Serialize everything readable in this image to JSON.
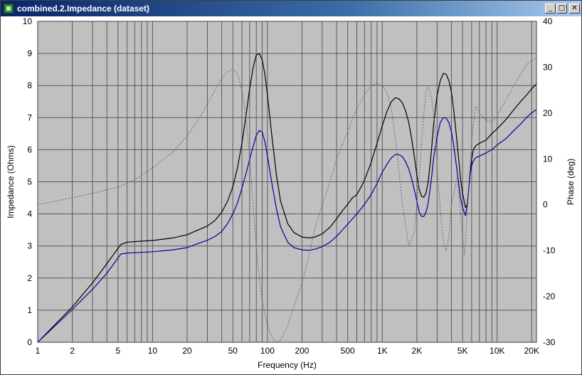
{
  "window": {
    "title": "combined.2.Impedance (dataset)",
    "min_label": "_",
    "max_label": "□",
    "close_label": "✕"
  },
  "colors": {
    "plot_bg": "#c0c0c0",
    "grid": "#5a5a5a",
    "series_black": "#000000",
    "series_blue": "#0000a0",
    "series_phase": "#6a6a6a"
  },
  "chart_data": {
    "type": "line",
    "xlabel": "Frequency (Hz)",
    "ylabel": "Impedance (Ohms)",
    "y2label": "Phase (deg)",
    "xscale": "log",
    "xlim": [
      1,
      22000
    ],
    "ylim": [
      0,
      10
    ],
    "y2lim": [
      -30,
      40
    ],
    "grid": true,
    "x_tick_labels": [
      {
        "value": 1,
        "label": "1"
      },
      {
        "value": 2,
        "label": "2"
      },
      {
        "value": 5,
        "label": "5"
      },
      {
        "value": 10,
        "label": "10"
      },
      {
        "value": 20,
        "label": "20"
      },
      {
        "value": 50,
        "label": "50"
      },
      {
        "value": 100,
        "label": "100"
      },
      {
        "value": 200,
        "label": "200"
      },
      {
        "value": 500,
        "label": "500"
      },
      {
        "value": 1000,
        "label": "1K"
      },
      {
        "value": 2000,
        "label": "2K"
      },
      {
        "value": 5000,
        "label": "5K"
      },
      {
        "value": 10000,
        "label": "10K"
      },
      {
        "value": 20000,
        "label": "20K"
      }
    ],
    "x_grid": [
      1,
      2,
      3,
      4,
      5,
      6,
      7,
      8,
      9,
      10,
      20,
      30,
      40,
      50,
      60,
      70,
      80,
      90,
      100,
      200,
      300,
      400,
      500,
      600,
      700,
      800,
      900,
      1000,
      2000,
      3000,
      4000,
      5000,
      6000,
      7000,
      8000,
      9000,
      10000,
      20000
    ],
    "y_ticks": [
      0,
      1,
      2,
      3,
      4,
      5,
      6,
      7,
      8,
      9,
      10
    ],
    "y2_ticks": [
      -30,
      -20,
      -10,
      0,
      10,
      20,
      30,
      40
    ],
    "series": [
      {
        "axis": "left",
        "style": "solid",
        "color": "#000000",
        "x": [
          1,
          2,
          3,
          4,
          5.3,
          6,
          8,
          10,
          15,
          20,
          25,
          30,
          35,
          40,
          45,
          50,
          55,
          60,
          65,
          70,
          75,
          80,
          85,
          90,
          95,
          100,
          110,
          120,
          130,
          150,
          170,
          200,
          230,
          260,
          300,
          350,
          400,
          450,
          500,
          550,
          600,
          650,
          700,
          800,
          900,
          1000,
          1100,
          1200,
          1300,
          1400,
          1500,
          1600,
          1700,
          1800,
          1900,
          2000,
          2100,
          2200,
          2300,
          2400,
          2500,
          2600,
          2700,
          2800,
          3000,
          3200,
          3400,
          3600,
          3800,
          4000,
          4200,
          4400,
          4600,
          4800,
          5000,
          5300,
          5500,
          5800,
          6000,
          6200,
          6500,
          7000,
          8000,
          9000,
          10000,
          12000,
          14000,
          16000,
          18000,
          20000,
          22000
        ],
        "y": [
          0,
          1.1,
          1.85,
          2.45,
          3.05,
          3.12,
          3.15,
          3.17,
          3.25,
          3.35,
          3.5,
          3.62,
          3.8,
          4.05,
          4.4,
          4.85,
          5.45,
          6.2,
          7.05,
          7.9,
          8.55,
          8.95,
          9,
          8.8,
          8.35,
          7.7,
          6.35,
          5.2,
          4.4,
          3.7,
          3.42,
          3.28,
          3.25,
          3.28,
          3.38,
          3.58,
          3.85,
          4.1,
          4.3,
          4.5,
          4.6,
          4.82,
          5.05,
          5.6,
          6.2,
          6.75,
          7.2,
          7.5,
          7.62,
          7.58,
          7.45,
          7.2,
          6.85,
          6.35,
          5.8,
          5.2,
          4.75,
          4.55,
          4.52,
          4.65,
          4.95,
          5.5,
          6.1,
          6.8,
          7.7,
          8.15,
          8.38,
          8.35,
          8.15,
          7.8,
          7.2,
          6.5,
          5.8,
          5.1,
          4.65,
          4.2,
          4.3,
          5.2,
          5.7,
          6,
          6.12,
          6.2,
          6.3,
          6.5,
          6.65,
          6.95,
          7.25,
          7.5,
          7.7,
          7.9,
          8.05
        ]
      },
      {
        "axis": "left",
        "style": "solid",
        "color": "#0000a0",
        "x": [
          1,
          2,
          3,
          4,
          5.3,
          6,
          8,
          10,
          15,
          20,
          25,
          30,
          35,
          40,
          45,
          50,
          55,
          60,
          65,
          70,
          75,
          80,
          85,
          90,
          95,
          100,
          110,
          120,
          130,
          150,
          170,
          200,
          230,
          260,
          300,
          350,
          400,
          450,
          500,
          550,
          600,
          650,
          700,
          800,
          900,
          1000,
          1100,
          1200,
          1300,
          1400,
          1500,
          1600,
          1700,
          1800,
          1900,
          2000,
          2100,
          2200,
          2300,
          2400,
          2500,
          2600,
          2700,
          2800,
          3000,
          3200,
          3400,
          3600,
          3800,
          4000,
          4200,
          4400,
          4600,
          4800,
          5000,
          5300,
          5500,
          5800,
          6000,
          6200,
          6500,
          7000,
          8000,
          9000,
          10000,
          12000,
          14000,
          16000,
          18000,
          20000,
          22000
        ],
        "y": [
          0,
          1.02,
          1.65,
          2.15,
          2.75,
          2.78,
          2.8,
          2.82,
          2.88,
          2.95,
          3.08,
          3.18,
          3.3,
          3.45,
          3.7,
          4,
          4.35,
          4.8,
          5.25,
          5.7,
          6.1,
          6.45,
          6.6,
          6.55,
          6.25,
          5.8,
          4.9,
          4.15,
          3.6,
          3.12,
          2.95,
          2.88,
          2.87,
          2.9,
          2.98,
          3.12,
          3.3,
          3.5,
          3.68,
          3.85,
          4,
          4.15,
          4.3,
          4.6,
          4.95,
          5.3,
          5.55,
          5.75,
          5.85,
          5.85,
          5.78,
          5.62,
          5.4,
          5.1,
          4.75,
          4.4,
          4.05,
          3.92,
          3.92,
          4.05,
          4.3,
          4.75,
          5.2,
          5.75,
          6.4,
          6.85,
          7,
          6.98,
          6.85,
          6.55,
          6.1,
          5.55,
          5,
          4.5,
          4.2,
          3.95,
          4.3,
          5.2,
          5.5,
          5.65,
          5.75,
          5.8,
          5.9,
          6,
          6.15,
          6.35,
          6.6,
          6.8,
          7,
          7.15,
          7.25
        ]
      },
      {
        "axis": "right",
        "style": "dashed",
        "color": "#6a6a6a",
        "x": [
          1,
          2,
          3,
          5,
          7,
          10,
          15,
          20,
          25,
          30,
          35,
          40,
          45,
          50,
          55,
          60,
          65,
          70,
          75,
          80,
          85,
          90,
          100,
          110,
          120,
          130,
          150,
          170,
          200,
          230,
          260,
          300,
          350,
          400,
          500,
          600,
          700,
          800,
          900,
          1000,
          1100,
          1200,
          1300,
          1400,
          1500,
          1700,
          1900,
          2000,
          2200,
          2400,
          2500,
          2700,
          2900,
          3000,
          3200,
          3400,
          3600,
          3800,
          4000,
          4500,
          5000,
          5200,
          5500,
          6000,
          6500,
          7000,
          8000,
          9000,
          10000,
          12000,
          14000,
          16000,
          18000,
          20000,
          22000
        ],
        "y": [
          0,
          1.5,
          2.5,
          3.8,
          5.5,
          8,
          11.5,
          15,
          18.5,
          22,
          25,
          27.5,
          29,
          29.5,
          28.5,
          25,
          19,
          10,
          0,
          -9,
          -16,
          -21,
          -26.5,
          -29,
          -30,
          -29.5,
          -26.5,
          -22,
          -17,
          -11,
          -5,
          0,
          5,
          10,
          16,
          21,
          24,
          26,
          26.5,
          26,
          24.5,
          21,
          14.5,
          7,
          0,
          -9,
          -6,
          0,
          14,
          25,
          26,
          23,
          16,
          8,
          -1,
          -8,
          -10,
          -7,
          0,
          6,
          -7,
          -11,
          -1,
          14,
          21.5,
          20,
          18.5,
          18,
          19.5,
          23,
          26,
          28.5,
          30.5,
          31.5,
          32
        ]
      }
    ]
  }
}
